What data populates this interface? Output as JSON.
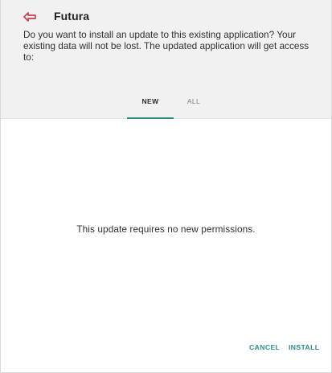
{
  "app": {
    "icon": "futura-red-arrow-icon",
    "title": "Futura"
  },
  "dialog": {
    "description": "Do you want to install an update to this existing application? Your existing data will not be lost. The updated application will get access to:",
    "message": "This update requires no new permissions."
  },
  "tabs": [
    {
      "label": "NEW",
      "selected": true
    },
    {
      "label": "ALL",
      "selected": false
    }
  ],
  "actions": {
    "cancel_label": "CANCEL",
    "install_label": "INSTALL"
  },
  "colors": {
    "header_background": "#f1f1f1",
    "accent": "#2a8f86",
    "icon": "#c9404f"
  }
}
